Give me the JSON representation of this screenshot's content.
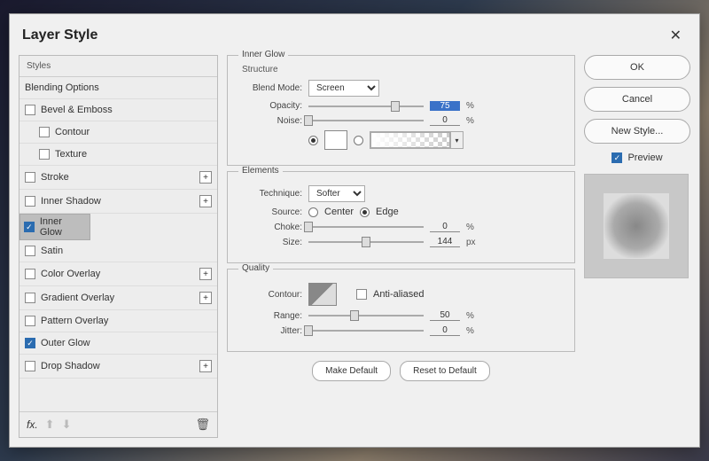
{
  "title": "Layer Style",
  "left": {
    "header": "Styles",
    "items": [
      {
        "label": "Blending Options",
        "checkable": false
      },
      {
        "label": "Bevel & Emboss",
        "checkable": true,
        "checked": false
      },
      {
        "label": "Contour",
        "checkable": true,
        "checked": false,
        "sub": true
      },
      {
        "label": "Texture",
        "checkable": true,
        "checked": false,
        "sub": true
      },
      {
        "label": "Stroke",
        "checkable": true,
        "checked": false,
        "plus": true
      },
      {
        "label": "Inner Shadow",
        "checkable": true,
        "checked": false,
        "plus": true
      },
      {
        "label": "Inner Glow",
        "checkable": true,
        "checked": true,
        "selected": true
      },
      {
        "label": "Satin",
        "checkable": true,
        "checked": false
      },
      {
        "label": "Color Overlay",
        "checkable": true,
        "checked": false,
        "plus": true
      },
      {
        "label": "Gradient Overlay",
        "checkable": true,
        "checked": false,
        "plus": true
      },
      {
        "label": "Pattern Overlay",
        "checkable": true,
        "checked": false
      },
      {
        "label": "Outer Glow",
        "checkable": true,
        "checked": true
      },
      {
        "label": "Drop Shadow",
        "checkable": true,
        "checked": false,
        "plus": true
      }
    ]
  },
  "panel": {
    "title": "Inner Glow",
    "structure": {
      "label": "Structure",
      "blend_mode_label": "Blend Mode:",
      "blend_mode": "Screen",
      "opacity_label": "Opacity:",
      "opacity": "75",
      "noise_label": "Noise:",
      "noise": "0",
      "pct": "%"
    },
    "elements": {
      "label": "Elements",
      "technique_label": "Technique:",
      "technique": "Softer",
      "source_label": "Source:",
      "center": "Center",
      "edge": "Edge",
      "choke_label": "Choke:",
      "choke": "0",
      "size_label": "Size:",
      "size": "144",
      "px": "px",
      "pct": "%"
    },
    "quality": {
      "label": "Quality",
      "contour_label": "Contour:",
      "aa": "Anti-aliased",
      "range_label": "Range:",
      "range": "50",
      "jitter_label": "Jitter:",
      "jitter": "0",
      "pct": "%"
    },
    "make_default": "Make Default",
    "reset_default": "Reset to Default"
  },
  "right": {
    "ok": "OK",
    "cancel": "Cancel",
    "new_style": "New Style...",
    "preview": "Preview"
  }
}
